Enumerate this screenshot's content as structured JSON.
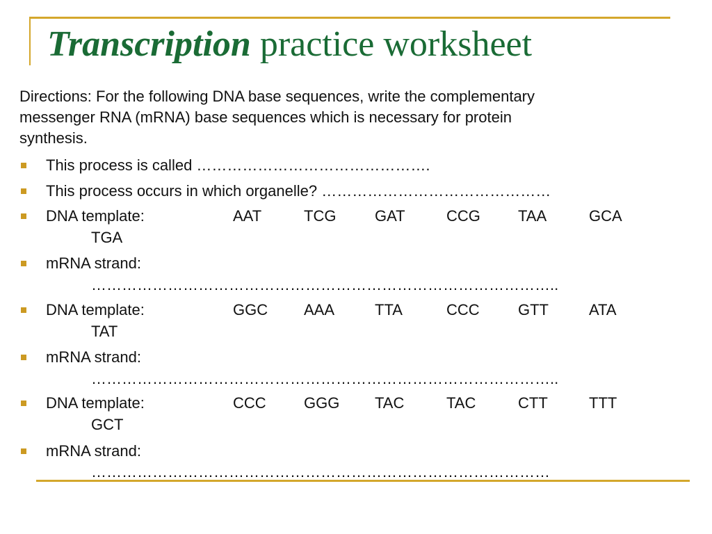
{
  "title": {
    "emphasis": "Transcription",
    "rest": " practice worksheet"
  },
  "directions": {
    "line1": "Directions: For the following DNA base sequences, write the complementary",
    "line2": "messenger RNA (mRNA) base sequences which is necessary for protein",
    "line3": "synthesis."
  },
  "questions": [
    {
      "label": "This process is called ",
      "blank": "……………………………………….",
      "bullet": "square-bullet"
    },
    {
      "label": "This process occurs in which organelle? ",
      "blank": "………………………………………",
      "bullet": "square-bullet"
    }
  ],
  "exercises": [
    {
      "dna_label": "DNA template:",
      "codons": [
        "AAT",
        "TCG",
        "GAT",
        "CCG",
        "TAA",
        "GCA"
      ],
      "continuation": "TGA",
      "mrna_label": "mRNA strand:",
      "mrna_blank": "……………………………………………………………………………….."
    },
    {
      "dna_label": "DNA template:",
      "codons": [
        "GGC",
        "AAA",
        "TTA",
        "CCC",
        "GTT",
        "ATA"
      ],
      "continuation": "TAT",
      "mrna_label": "mRNA strand:",
      "mrna_blank": "……………………………………………………………………………….."
    },
    {
      "dna_label": "DNA template:",
      "codons": [
        "CCC",
        "GGG",
        "TAC",
        "TAC",
        "CTT",
        "TTT"
      ],
      "continuation": "GCT",
      "mrna_label": "mRNA strand:",
      "mrna_blank": "………………………………………………………………………………"
    }
  ],
  "colors": {
    "title": "#1a6b35",
    "accent_rule": "#d4a72c",
    "bullet": "#cc9a22",
    "text": "#111111"
  }
}
